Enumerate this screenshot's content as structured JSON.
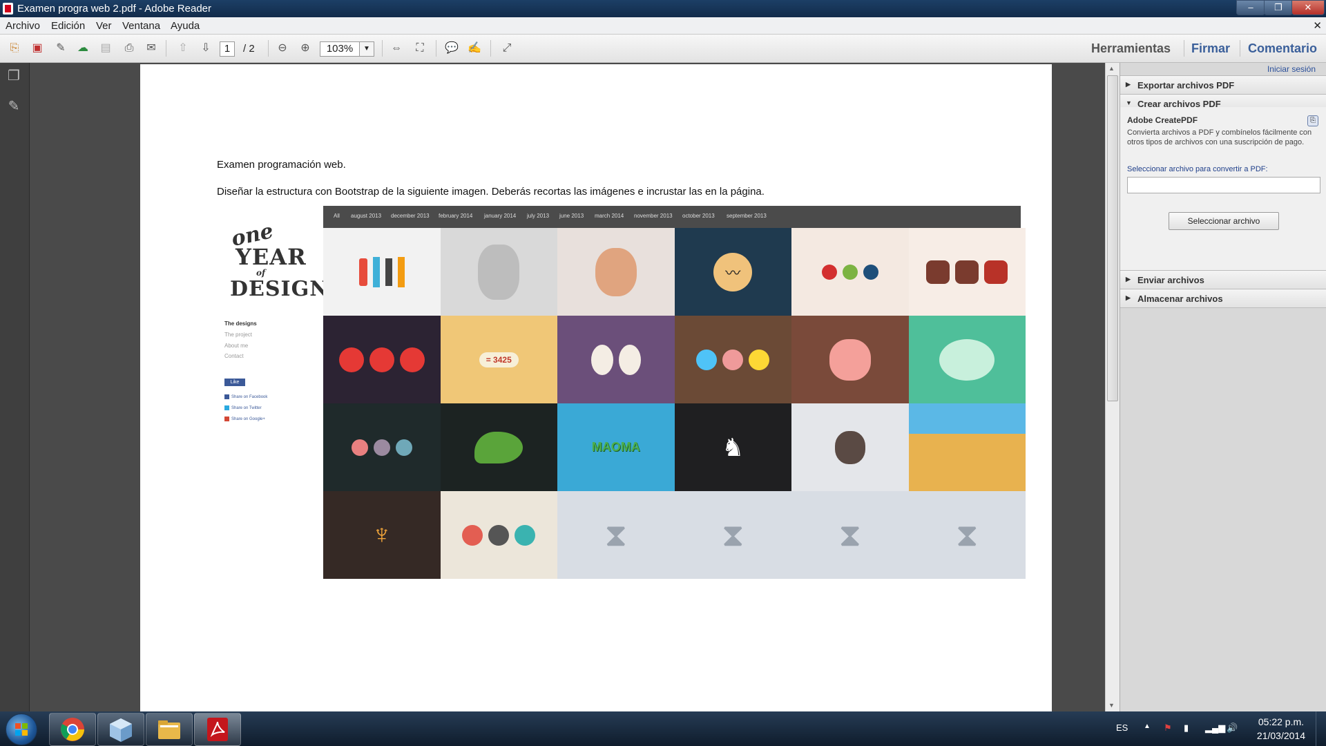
{
  "window": {
    "title": "Examen progra web 2.pdf - Adobe Reader",
    "controls": {
      "minimize": "–",
      "maximize": "❐",
      "close": "✕"
    }
  },
  "menu": [
    "Archivo",
    "Edición",
    "Ver",
    "Ventana",
    "Ayuda"
  ],
  "toolbar": {
    "page_current": "1",
    "page_total": "/ 2",
    "zoom": "103%",
    "right_tabs": [
      "Herramientas",
      "Firmar",
      "Comentario"
    ]
  },
  "document": {
    "line1": "Examen programación web.",
    "line2": "Diseñar la estructura con Bootstrap de la siguiente imagen.  Deberás recortas las imágenes e incrustar las en la página.",
    "mockup": {
      "logo": {
        "one": "one",
        "year": "YEAR",
        "of": "of",
        "design": "DESIGN"
      },
      "nav": [
        "The designs",
        "The project",
        "About me",
        "Contact"
      ],
      "like": "Like",
      "share": [
        "Share on Facebook",
        "Share on Twitter",
        "Share on Google+"
      ],
      "filters": [
        "All",
        "august 2013",
        "december 2013",
        "february 2014",
        "january 2014",
        "july 2013",
        "june 2013",
        "march 2014",
        "november 2013",
        "october 2013",
        "september 2013"
      ],
      "coin_text": "= 3425",
      "tiles": [
        {
          "bg": "#f2f2f2",
          "icon": "stationery-icons"
        },
        {
          "bg": "#d9d9d9",
          "icon": "sketch-man-portrait"
        },
        {
          "bg": "#e8e0dc",
          "icon": "masked-hero-portrait"
        },
        {
          "bg": "#1f3a4f",
          "icon": "mustache-face-icon"
        },
        {
          "bg": "#f4e9e1",
          "icon": "fruit-dots-icons"
        },
        {
          "bg": "#f7ede6",
          "icon": "tools-icons"
        },
        {
          "bg": "#2c2333",
          "icon": "red-monsters-icons"
        },
        {
          "bg": "#f0c777",
          "icon": "coin-counter"
        },
        {
          "bg": "#6b4f7a",
          "icon": "eggs-characters"
        },
        {
          "bg": "#6b4a36",
          "icon": "monster-faces-icons"
        },
        {
          "bg": "#7a4a3a",
          "icon": "pig-knife-illustration"
        },
        {
          "bg": "#4fbf9a",
          "icon": "eagle-character"
        },
        {
          "bg": "#1f2a2b",
          "icon": "animal-faces-icons"
        },
        {
          "bg": "#1c2322",
          "icon": "crocodile-head"
        },
        {
          "bg": "#3aa9d6",
          "icon": "maooma-logo"
        },
        {
          "bg": "#1f1f21",
          "icon": "wolf-silhouette"
        },
        {
          "bg": "#e4e6ea",
          "icon": "skull-pirate"
        },
        {
          "bg": "#e8b24f",
          "icon": "desert-landscape"
        },
        {
          "bg": "#352925",
          "icon": "moose-head-icon"
        },
        {
          "bg": "#ece6da",
          "icon": "food-icons"
        },
        {
          "bg": "#d8dde4",
          "icon": "hourglass-icon"
        },
        {
          "bg": "#d8dde4",
          "icon": "hourglass-icon"
        },
        {
          "bg": "#d8dde4",
          "icon": "hourglass-icon"
        },
        {
          "bg": "#d8dde4",
          "icon": "hourglass-icon"
        }
      ]
    }
  },
  "panel": {
    "signin": "Iniciar sesión",
    "sections": [
      "Exportar archivos PDF",
      "Crear archivos PDF",
      "Enviar archivos",
      "Almacenar archivos"
    ],
    "create": {
      "title": "Adobe CreatePDF",
      "description": "Convierta archivos a PDF y combínelos fácilmente con otros tipos de archivos con una suscripción de pago.",
      "label": "Seleccionar archivo para convertir a PDF:",
      "button": "Seleccionar archivo"
    }
  },
  "taskbar": {
    "lang": "ES",
    "time": "05:22 p.m.",
    "date": "21/03/2014"
  },
  "colors": {
    "titlebar": "#1c3f66",
    "acrobat_red": "#d0021b",
    "panel_link": "#2a4f9a"
  }
}
